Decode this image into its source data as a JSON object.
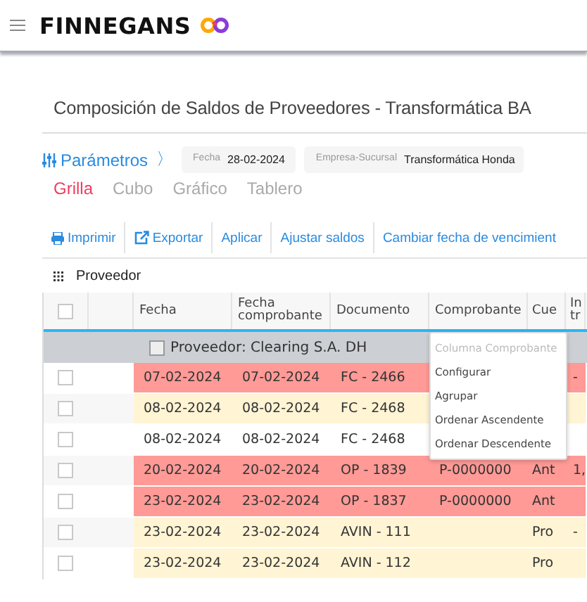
{
  "header": {
    "brand": "FINNEGANS"
  },
  "page": {
    "title": "Composición de Saldos de Proveedores - Transformática BA"
  },
  "parameters": {
    "label": "Parámetros",
    "chevron": "〉",
    "fields": [
      {
        "label": "Fecha",
        "value": "28-02-2024"
      },
      {
        "label": "Empresa-Sucursal",
        "value": "Transformática Honda"
      }
    ]
  },
  "views": [
    {
      "label": "Grilla",
      "selected": true
    },
    {
      "label": "Cubo",
      "selected": false
    },
    {
      "label": "Gráfico",
      "selected": false
    },
    {
      "label": "Tablero",
      "selected": false
    }
  ],
  "toolbar": [
    {
      "label": "Imprimir"
    },
    {
      "label": "Exportar"
    },
    {
      "label": "Aplicar"
    },
    {
      "label": "Ajustar saldos"
    },
    {
      "label": "Cambiar fecha de vencimient"
    }
  ],
  "grouping": {
    "label": "Proveedor"
  },
  "table": {
    "all_checked": false,
    "columns": [
      "Fecha",
      "Fecha comprobante",
      "Documento",
      "Comprobante",
      "Cue",
      "In tr"
    ],
    "group": {
      "label": "Proveedor: Clearing S.A. DH",
      "checked": false
    },
    "rows": [
      {
        "color": "#ff9a96",
        "checked": false,
        "cells": [
          "07-02-2024",
          "07-02-2024",
          "FC - 2466",
          null,
          null,
          "-"
        ]
      },
      {
        "color": "#fff4d4",
        "checked": false,
        "cells": [
          "08-02-2024",
          "08-02-2024",
          "FC - 2468",
          null,
          null,
          null
        ]
      },
      {
        "color": "#ffffff",
        "checked": false,
        "cells": [
          "08-02-2024",
          "08-02-2024",
          "FC - 2468",
          null,
          null,
          null
        ]
      },
      {
        "color": "#ff9a96",
        "checked": false,
        "cells": [
          "20-02-2024",
          "20-02-2024",
          "OP - 1839",
          "P-0000000",
          "Ant",
          "1,"
        ]
      },
      {
        "color": "#ff9a96",
        "checked": false,
        "cells": [
          "23-02-2024",
          "23-02-2024",
          "OP - 1837",
          "P-0000000",
          "Ant",
          null
        ]
      },
      {
        "color": "#fff4d4",
        "checked": false,
        "cells": [
          "23-02-2024",
          "23-02-2024",
          "AVIN - 111",
          null,
          "Pro",
          "-"
        ]
      },
      {
        "color": "#fff4d4",
        "checked": false,
        "cells": [
          "23-02-2024",
          "23-02-2024",
          "AVIN - 112",
          null,
          "Pro",
          null
        ]
      }
    ]
  },
  "column_menu": {
    "items": [
      {
        "label": "Columna Comprobante",
        "disabled": true
      },
      {
        "label": "Configurar",
        "disabled": false
      },
      {
        "label": "Agrupar",
        "disabled": false
      },
      {
        "label": "Ordenar Ascendente",
        "disabled": false
      },
      {
        "label": "Ordenar Descendente",
        "disabled": false
      }
    ]
  }
}
